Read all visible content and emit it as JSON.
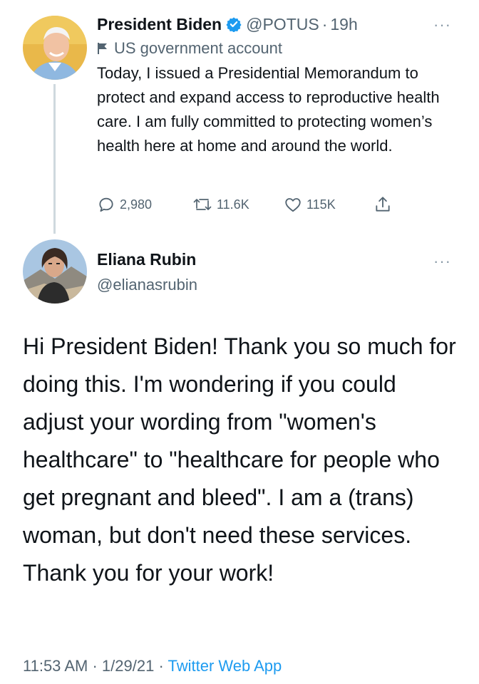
{
  "tweet1": {
    "author_name": "President Biden",
    "handle": "@POTUS",
    "separator": "·",
    "time": "19h",
    "gov_label": "US government account",
    "text": "Today, I issued a Presidential Memorandum to protect and expand access to reproductive health care. I am fully committed to protecting women’s health here at home and around the world.",
    "reply_count": "2,980",
    "retweet_count": "11.6K",
    "like_count": "115K",
    "more": "···"
  },
  "tweet2": {
    "author_name": "Eliana Rubin",
    "handle": "@elianasrubin",
    "text": "Hi President Biden! Thank you so much for doing this. I'm wondering if you could adjust your wording from \"women's healthcare\" to \"healthcare for people who get pregnant and bleed\". I am a (trans) woman, but don't need these services. Thank you for your work!",
    "more": "···",
    "time": "11:53 AM",
    "separator": "·",
    "date": "1/29/21",
    "source": "Twitter Web App"
  },
  "colors": {
    "verified": "#1d9bf0",
    "link": "#1d9bf0",
    "secondary_text": "#536471",
    "thread_line": "#cfd9de"
  },
  "icons": {
    "verified": "verified-badge-icon",
    "gov": "flag-icon",
    "reply": "reply-icon",
    "retweet": "retweet-icon",
    "like": "heart-icon",
    "share": "share-icon"
  }
}
